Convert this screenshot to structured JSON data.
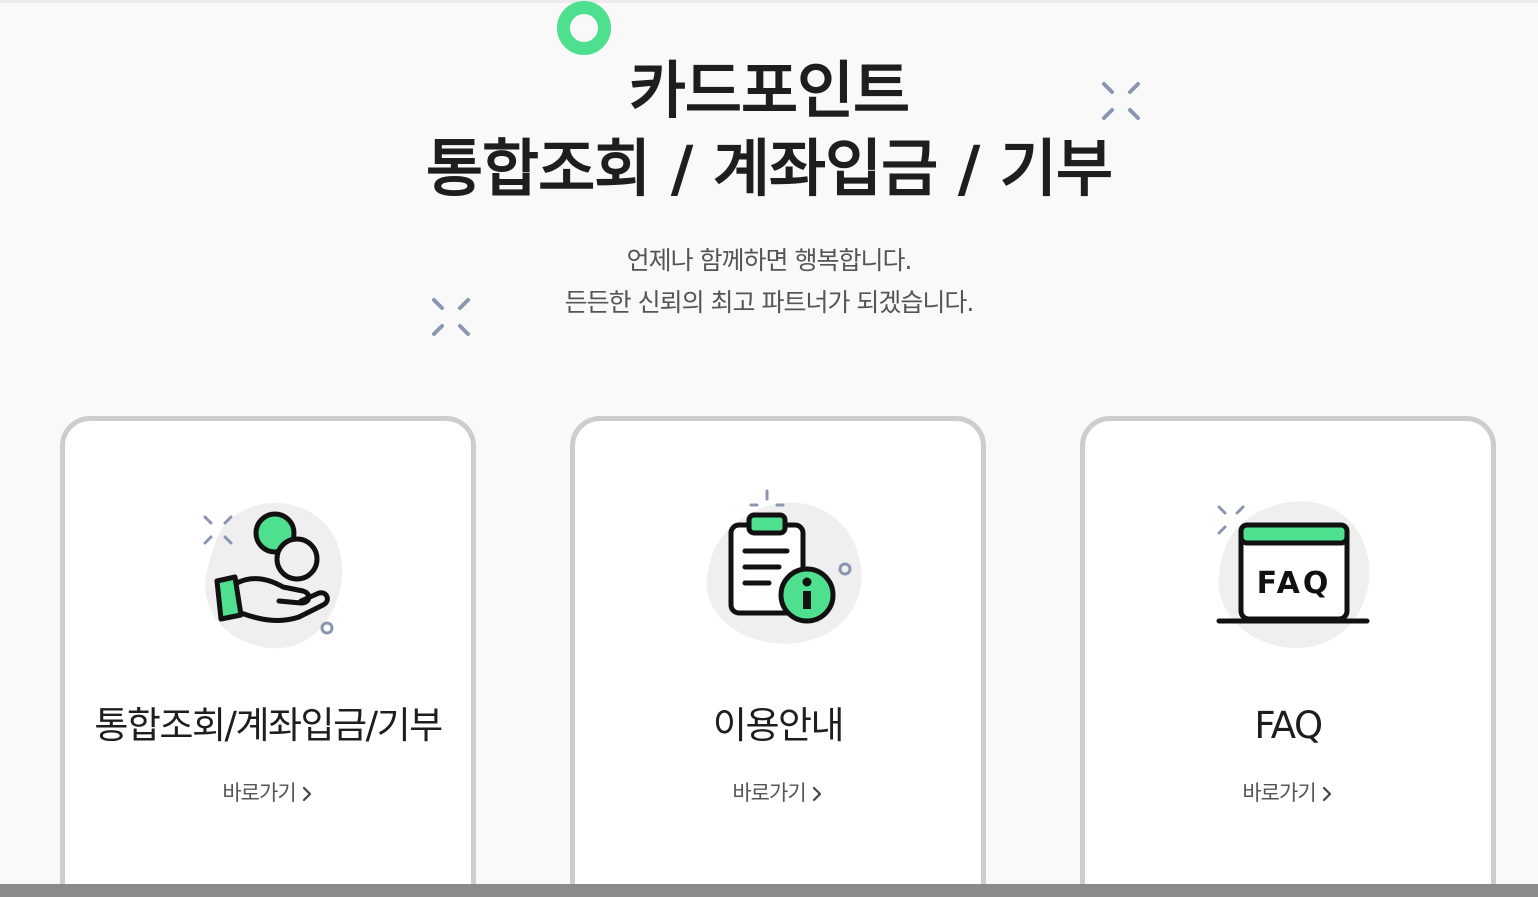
{
  "header": {
    "title_line1": "카드포인트",
    "title_line2": "통합조회 / 계좌입금 / 기부",
    "subtitle_line1": "언제나 함께하면 행복합니다.",
    "subtitle_line2": "든든한 신뢰의 최고 파트너가 되겠습니다."
  },
  "colors": {
    "accent": "#4fe08f",
    "sparkle": "#8a96b0",
    "card_border": "#cdcdcd",
    "blob": "#efefef"
  },
  "cards": [
    {
      "title": "통합조회/계좌입금/기부",
      "link_label": "바로가기",
      "icon": "hand-coins-icon"
    },
    {
      "title": "이용안내",
      "link_label": "바로가기",
      "icon": "clipboard-info-icon"
    },
    {
      "title": "FAQ",
      "link_label": "바로가기",
      "icon": "faq-window-icon",
      "icon_text": "FAQ"
    }
  ]
}
